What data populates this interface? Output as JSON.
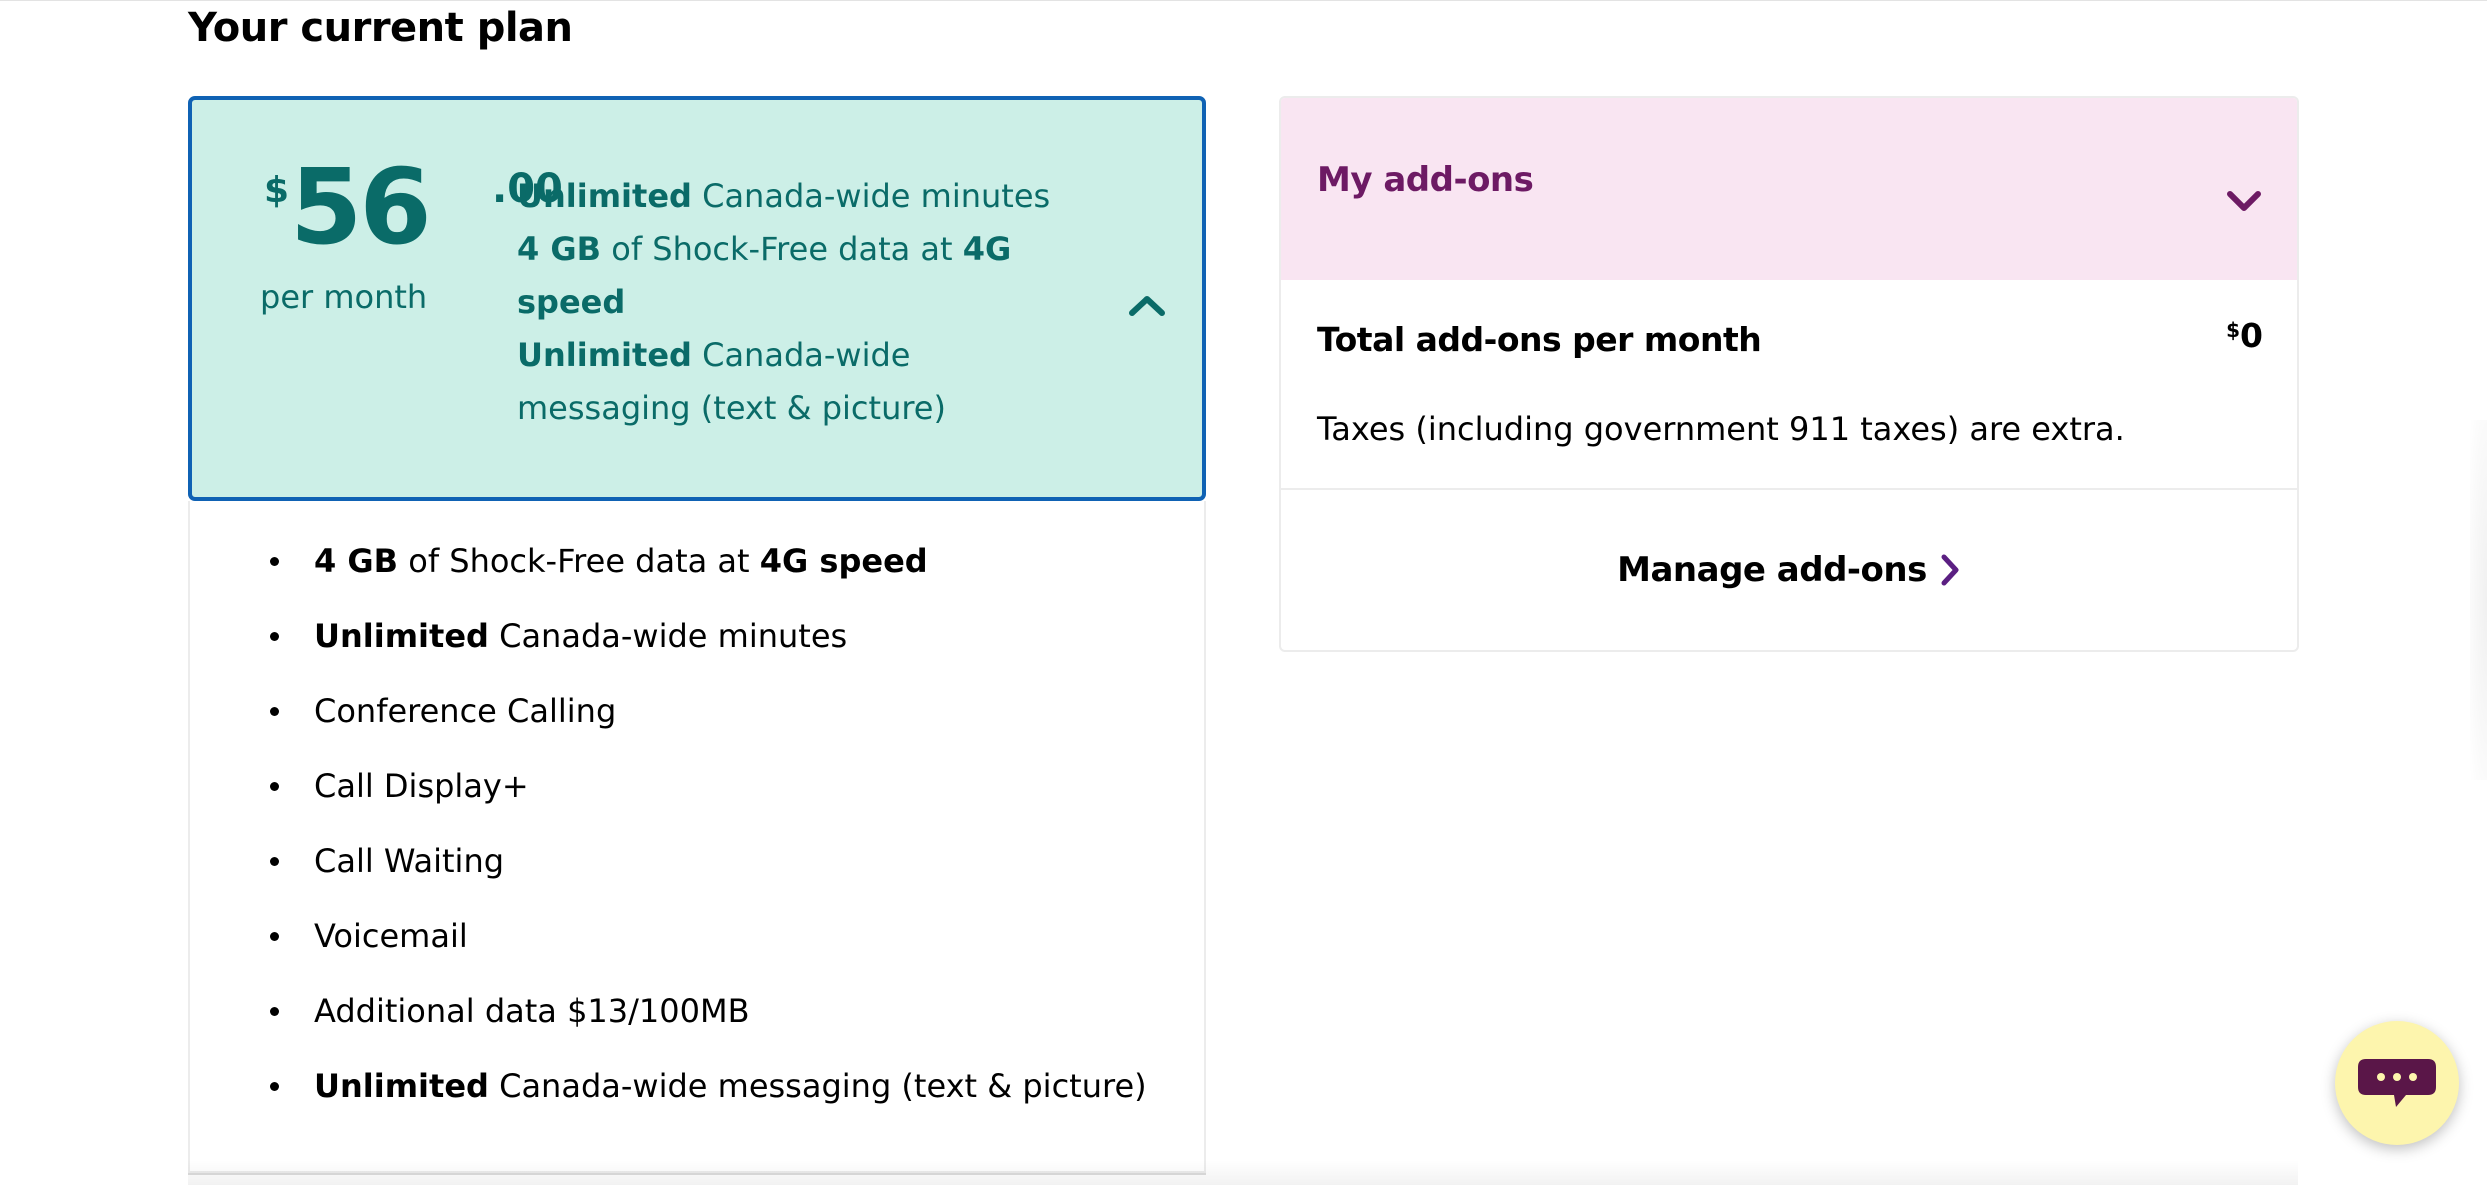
{
  "page": {
    "title": "Your current plan"
  },
  "plan": {
    "price": {
      "currency": "$",
      "dollars": "56",
      "cents": ".00",
      "period": "per month"
    },
    "summary": [
      {
        "bold": "Unlimited",
        "text": " Canada-wide minutes"
      },
      {
        "bold": "4 GB",
        "text": " of Shock-Free data at ",
        "bold2": "4G speed"
      },
      {
        "bold": "Unlimited",
        "text": " Canada-wide messaging (text & picture)"
      }
    ],
    "features": [
      {
        "bold": "4 GB",
        "text": " of Shock-Free data at ",
        "bold2": "4G speed"
      },
      {
        "bold": "Unlimited",
        "text": " Canada-wide minutes"
      },
      {
        "text": "Conference Calling"
      },
      {
        "text": "Call Display+"
      },
      {
        "text": "Call Waiting"
      },
      {
        "text": "Voicemail"
      },
      {
        "text": "Additional data $13/100MB"
      },
      {
        "bold": "Unlimited",
        "text": " Canada-wide messaging (text & picture)"
      }
    ],
    "toggle_icon": "chevron-up-icon"
  },
  "addons": {
    "title": "My add-ons",
    "toggle_icon": "chevron-down-icon",
    "total_label": "Total add-ons per month",
    "total_currency": "$",
    "total_value": "0",
    "taxes_note": "Taxes (including government 911 taxes) are extra.",
    "manage_label": "Manage add-ons",
    "manage_icon": "chevron-right-icon"
  },
  "chat": {
    "icon": "chat-bubble-icon"
  },
  "colors": {
    "plan_bg": "#ccefe7",
    "plan_border": "#0f62b4",
    "plan_text": "#0a6b68",
    "addons_bg": "#f9e5f2",
    "addons_title": "#6d1a64",
    "manage_chevron": "#5b1f82",
    "chat_bg": "#fdf5ad",
    "chat_icon": "#5a1648"
  }
}
